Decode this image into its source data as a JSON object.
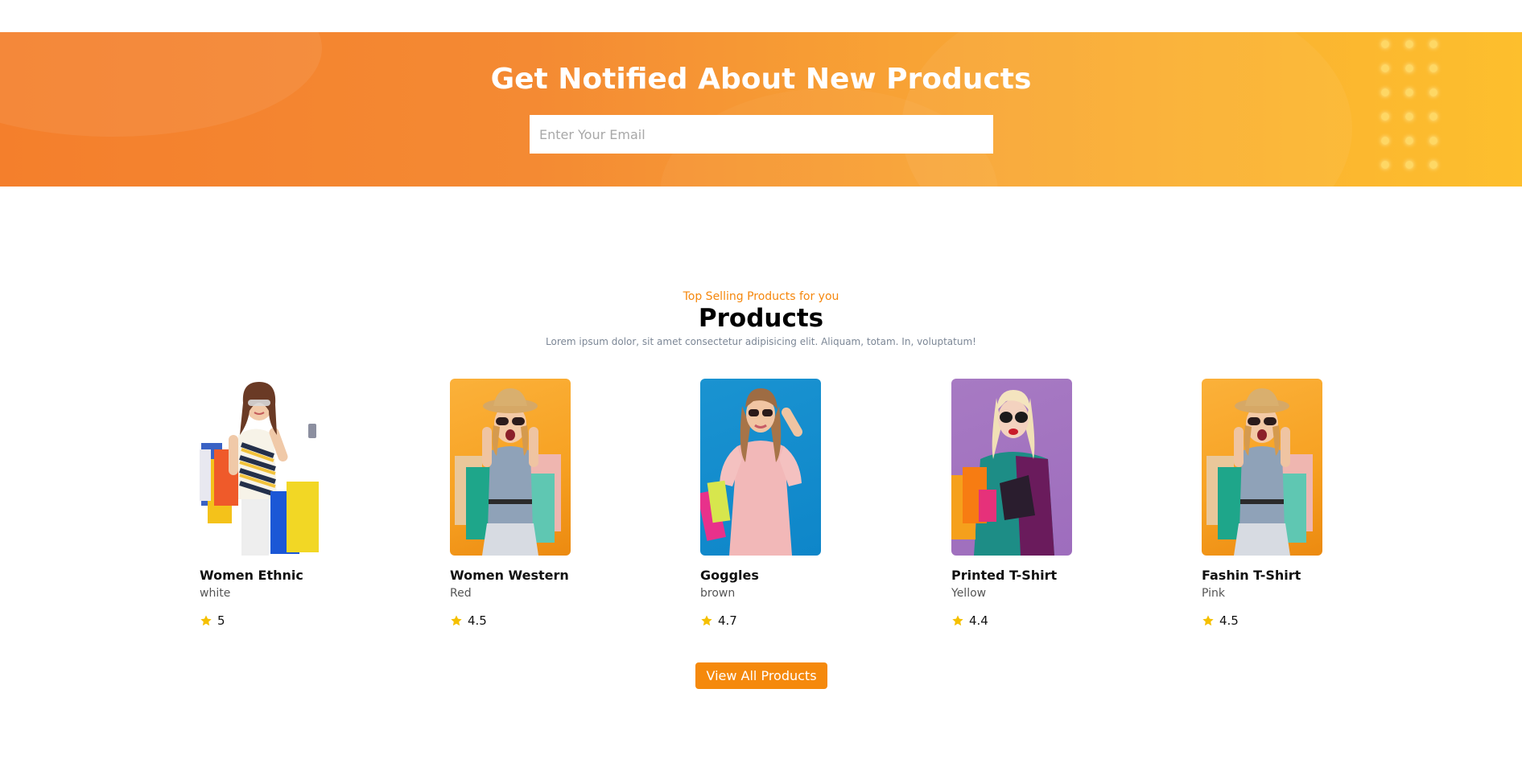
{
  "newsletter": {
    "title": "Get Notified About New Products",
    "email_placeholder": "Enter Your Email"
  },
  "products_section": {
    "eyebrow": "Top Selling Products for you",
    "title": "Products",
    "description": "Lorem ipsum dolor, sit amet consectetur adipisicing elit. Aliquam, totam. In, voluptatum!",
    "items": [
      {
        "name": "Women Ethnic",
        "color": "white",
        "rating": "5",
        "photo_background": "white"
      },
      {
        "name": "Women Western",
        "color": "Red",
        "rating": "4.5",
        "photo_background": "orange"
      },
      {
        "name": "Goggles",
        "color": "brown",
        "rating": "4.7",
        "photo_background": "blue"
      },
      {
        "name": "Printed T-Shirt",
        "color": "Yellow",
        "rating": "4.4",
        "photo_background": "purple"
      },
      {
        "name": "Fashin T-Shirt",
        "color": "Pink",
        "rating": "4.5",
        "photo_background": "orange"
      }
    ],
    "cta_label": "View All Products"
  },
  "colors": {
    "accent": "#f5890c",
    "star": "#f5c000",
    "banner_start": "#f47f2c",
    "banner_end": "#fdbf2d"
  },
  "icons": {
    "rating": "star-icon"
  }
}
